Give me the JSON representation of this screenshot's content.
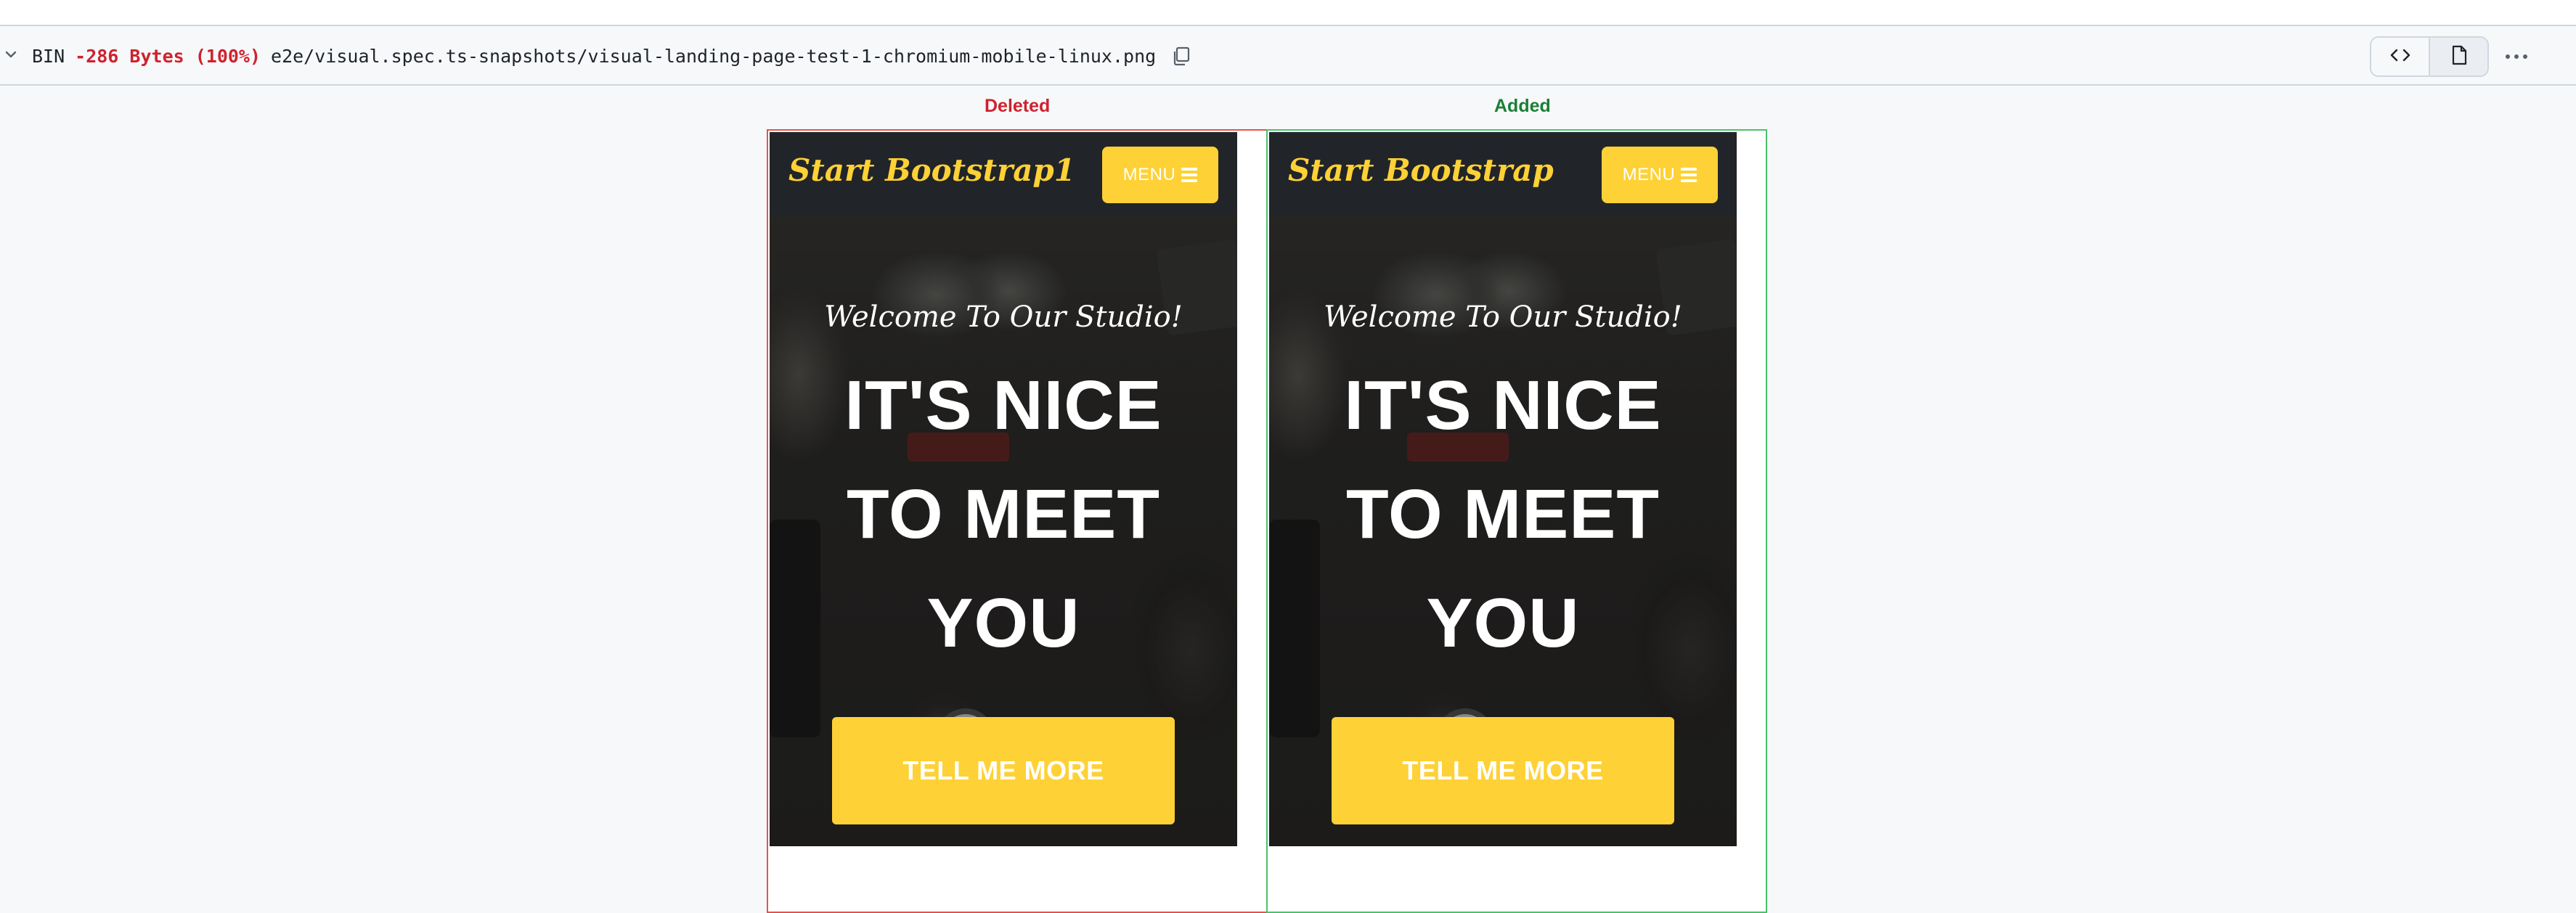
{
  "file": {
    "type_label": "BIN",
    "diffstat": "-286 Bytes (100%)",
    "path": "e2e/visual.spec.ts-snapshots/visual-landing-page-test-1-chromium-mobile-linux.png"
  },
  "view_toggle": {
    "code_icon": "code-icon",
    "file_icon": "file-icon"
  },
  "labels": {
    "deleted": "Deleted",
    "added": "Added"
  },
  "deleted_shot": {
    "brand": "Start Bootstrap1",
    "menu_label": "MENU",
    "welcome": "Welcome To Our Studio!",
    "headline_line1": "IT'S NICE",
    "headline_line2": "TO MEET",
    "headline_line3": "YOU",
    "cta": "TELL ME MORE"
  },
  "added_shot": {
    "brand": "Start Bootstrap",
    "menu_label": "MENU",
    "welcome": "Welcome To Our Studio!",
    "headline_line1": "IT'S NICE",
    "headline_line2": "TO MEET",
    "headline_line3": "YOU",
    "cta": "TELL ME MORE"
  },
  "colors": {
    "deleted": "#cf222e",
    "added": "#1a7f37",
    "accent_yellow": "#fed136",
    "navbar_dark": "#212529"
  }
}
